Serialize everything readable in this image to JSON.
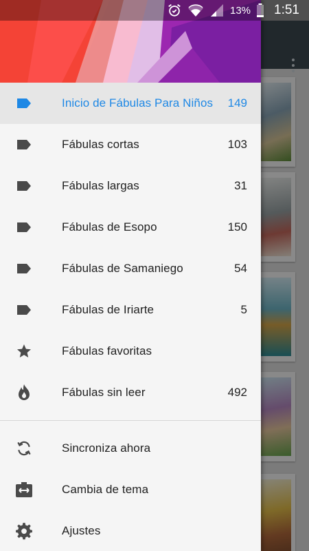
{
  "status_bar": {
    "battery": "13%",
    "time": "1:51"
  },
  "drawer": {
    "items": [
      {
        "label": "Inicio de Fábulas Para Niños",
        "count": "149",
        "icon": "label-icon",
        "active": true
      },
      {
        "label": "Fábulas cortas",
        "count": "103",
        "icon": "label-icon"
      },
      {
        "label": "Fábulas largas",
        "count": "31",
        "icon": "label-icon"
      },
      {
        "label": "Fábulas de Esopo",
        "count": "150",
        "icon": "label-icon"
      },
      {
        "label": "Fábulas de Samaniego",
        "count": "54",
        "icon": "label-icon"
      },
      {
        "label": "Fábulas de Iriarte",
        "count": "5",
        "icon": "label-icon"
      },
      {
        "label": "Fábulas favoritas",
        "count": "",
        "icon": "star-icon"
      },
      {
        "label": "Fábulas sin leer",
        "count": "492",
        "icon": "flame-icon"
      }
    ],
    "actions": [
      {
        "label": "Sincroniza ahora",
        "icon": "sync-icon"
      },
      {
        "label": "Cambia de tema",
        "icon": "switch-theme-icon"
      },
      {
        "label": "Ajustes",
        "icon": "gear-icon"
      }
    ]
  },
  "colors": {
    "accent": "#1e88e5",
    "header_red": "#e53935",
    "header_purple": "#8e24aa",
    "toolbar": "#3c4a50"
  }
}
